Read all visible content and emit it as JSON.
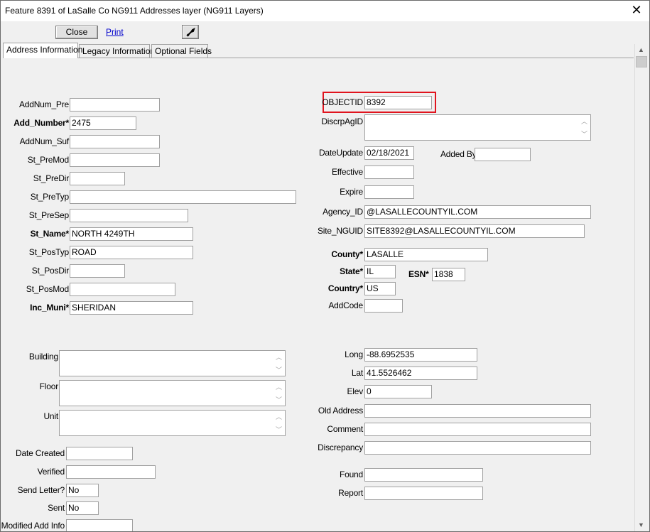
{
  "window": {
    "title": "Feature 8391 of LaSalle Co NG911 Addresses layer  (NG911 Layers)"
  },
  "toolbar": {
    "close_label": "Close",
    "print_label": "Print"
  },
  "tabs": [
    "Address Information",
    "Legacy Information",
    "Optional Fields"
  ],
  "left_fields": [
    {
      "label": "AddNum_Pre",
      "value": "",
      "required": false
    },
    {
      "label": "Add_Number*",
      "value": "2475",
      "required": true
    },
    {
      "label": "AddNum_Suf",
      "value": "",
      "required": false
    },
    {
      "label": "St_PreMod",
      "value": "",
      "required": false
    },
    {
      "label": "St_PreDir",
      "value": "",
      "required": false
    },
    {
      "label": "St_PreTyp",
      "value": "",
      "required": false
    },
    {
      "label": "St_PreSep",
      "value": "",
      "required": false
    },
    {
      "label": "St_Name*",
      "value": "NORTH 4249TH",
      "required": true
    },
    {
      "label": "St_PosTyp",
      "value": "ROAD",
      "required": false
    },
    {
      "label": "St_PosDir",
      "value": "",
      "required": false
    },
    {
      "label": "St_PosMod",
      "value": "",
      "required": false
    },
    {
      "label": "Inc_Muni*",
      "value": "SHERIDAN",
      "required": true
    }
  ],
  "left_memos": [
    {
      "label": "Building",
      "value": ""
    },
    {
      "label": "Floor",
      "value": ""
    },
    {
      "label": "Unit",
      "value": ""
    }
  ],
  "left_bottom": [
    {
      "label": "Date Created",
      "value": ""
    },
    {
      "label": "Verified",
      "value": ""
    },
    {
      "label": "Send Letter?",
      "value": "No"
    },
    {
      "label": "Sent",
      "value": "No"
    },
    {
      "label": "Modified Add Info",
      "value": ""
    }
  ],
  "right_fields": {
    "objectid": {
      "label": "OBJECTID",
      "value": "8392"
    },
    "discrpagid": {
      "label": "DiscrpAgID",
      "value": ""
    },
    "dateupdate": {
      "label": "DateUpdate",
      "value": "02/18/2021"
    },
    "addedby": {
      "label": "Added By",
      "value": ""
    },
    "effective": {
      "label": "Effective",
      "value": ""
    },
    "expire": {
      "label": "Expire",
      "value": ""
    },
    "agency_id": {
      "label": "Agency_ID",
      "value": "@LASALLECOUNTYIL.COM"
    },
    "site_nguid": {
      "label": "Site_NGUID",
      "value": "SITE8392@LASALLECOUNTYIL.COM"
    },
    "county": {
      "label": "County*",
      "value": "LASALLE"
    },
    "state": {
      "label": "State*",
      "value": "IL"
    },
    "esn": {
      "label": "ESN*",
      "value": "1838"
    },
    "country": {
      "label": "Country*",
      "value": "US"
    },
    "addcode": {
      "label": "AddCode",
      "value": ""
    }
  },
  "right_lower": [
    {
      "label": "Long",
      "value": "-88.6952535"
    },
    {
      "label": "Lat",
      "value": "41.5526462"
    },
    {
      "label": "Elev",
      "value": "0"
    },
    {
      "label": "Old Address",
      "value": ""
    },
    {
      "label": "Comment",
      "value": ""
    },
    {
      "label": "Discrepancy",
      "value": ""
    },
    {
      "label": "Found",
      "value": ""
    },
    {
      "label": "Report",
      "value": ""
    }
  ],
  "colors": {
    "highlight": "#e0141e",
    "link": "#0000cc"
  }
}
